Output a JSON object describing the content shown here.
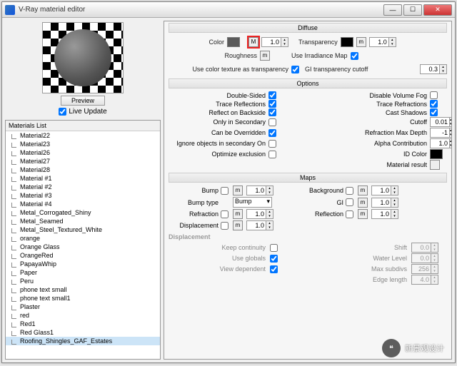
{
  "window": {
    "title": "V-Ray material editor"
  },
  "preview": {
    "btn": "Preview",
    "live": "Live Update"
  },
  "matlist": {
    "header": "Materials List",
    "items": [
      "Material22",
      "Material23",
      "Material26",
      "Material27",
      "Material28",
      "Material #1",
      "Material #2",
      "Material #3",
      "Material #4",
      "Metal_Corrogated_Shiny",
      "Metal_Seamed",
      "Metal_Steel_Textured_White",
      "orange",
      "Orange Glass",
      "OrangeRed",
      "PapayaWhip",
      "Paper",
      "Peru",
      "phone text small",
      "phone text small1",
      "Plaster",
      "red",
      "Red1",
      "Red Glass1",
      "Roofing_Shingles_GAF_Estates"
    ],
    "selected": 24
  },
  "diffuse": {
    "hdr": "Diffuse",
    "color": "Color",
    "color_m_val": "1.0",
    "transparency": "Transparency",
    "trans_val": "1.0",
    "roughness": "Roughness",
    "roughness_mlbl": "m",
    "use_irr": "Use Irradiance Map",
    "use_color_tex": "Use color texture as transparency",
    "gi_cutoff": "GI transparency cutoff",
    "gi_cutoff_val": "0.3"
  },
  "options": {
    "hdr": "Options",
    "double_sided": "Double-Sided",
    "disable_vf": "Disable Volume Fog",
    "trace_refl": "Trace Reflections",
    "trace_refr": "Trace Refractions",
    "refl_back": "Reflect on Backside",
    "cast_sh": "Cast Shadows",
    "only_sec": "Only in Secondary",
    "cutoff": "Cutoff",
    "cutoff_val": "0.01",
    "can_over": "Can be Overridden",
    "refr_max": "Refraction Max Depth",
    "refr_max_val": "-1",
    "ignore_sec": "Ignore objects in secondary On",
    "alpha": "Alpha Contribution",
    "alpha_val": "1.0",
    "opt_excl": "Optimize exclusion",
    "id_color": "ID Color",
    "mat_result": "Material result"
  },
  "maps": {
    "hdr": "Maps",
    "bump": "Bump",
    "bump_val": "1.0",
    "background": "Background",
    "bg_val": "1.0",
    "bump_type": "Bump type",
    "bump_type_val": "Bump",
    "gi": "GI",
    "gi_val": "1.0",
    "refraction": "Refraction",
    "refr_val": "1.0",
    "reflection": "Reflection",
    "refl_val": "1.0",
    "displacement": "Displacement",
    "disp_val": "1.0",
    "disp_hdr": "Displacement",
    "keep_cont": "Keep continuity",
    "shift": "Shift",
    "shift_val": "0.0",
    "use_glob": "Use globals",
    "water": "Water Level",
    "water_val": "0.0",
    "view_dep": "View dependent",
    "max_sub": "Max subdivs",
    "max_sub_val": "256",
    "edge_len": "Edge length",
    "edge_len_val": "4.0"
  },
  "watermark": "新景观设计"
}
